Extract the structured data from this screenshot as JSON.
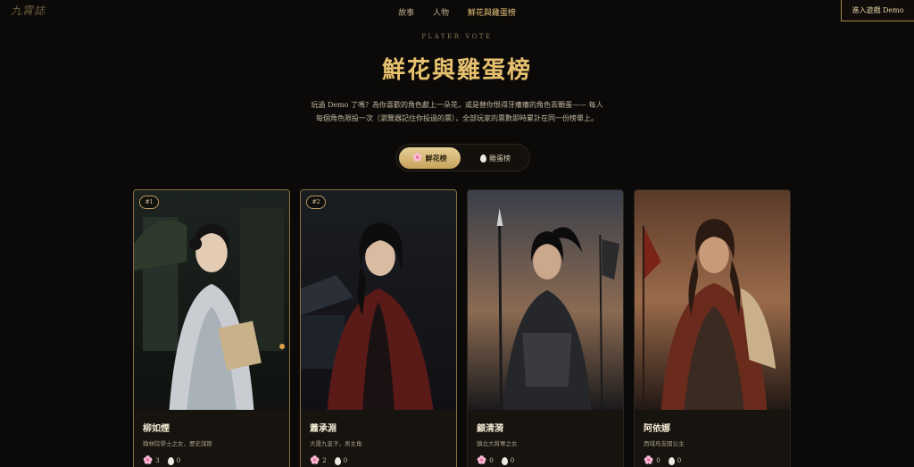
{
  "header": {
    "logo": "九霄誌",
    "nav": [
      "故事",
      "人物",
      "鮮花與雞蛋榜"
    ],
    "enter_button": "進入遊戲 Demo"
  },
  "hero": {
    "eyebrow": "PLAYER VOTE",
    "title": "鮮花與雞蛋榜",
    "description_line1": "玩過 Demo 了嗎？為你喜歡的角色獻上一朵花，或是替你恨得牙癢癢的角色丟顆蛋—— 每人",
    "description_line2": "每個角色限投一次（瀏覽器記住你投過的票），全部玩家的票數即時累計在同一份榜單上。"
  },
  "toggle": {
    "flower": "鮮花榜",
    "egg": "雞蛋榜",
    "selected": "鮮花榜"
  },
  "cards": [
    {
      "rank": "#1",
      "name": "柳如煙",
      "role": "翰林院學士之女，歷史謀斯",
      "flowers": "3",
      "eggs": "0"
    },
    {
      "rank": "#2",
      "name": "蕭承淵",
      "role": "大晟九皇子，男主角",
      "flowers": "2",
      "eggs": "0"
    },
    {
      "rank": "",
      "name": "顧清漪",
      "role": "鎮北大將軍之女",
      "flowers": "0",
      "eggs": "0"
    },
    {
      "rank": "",
      "name": "阿依娜",
      "role": "西域烏支國公主",
      "flowers": "0",
      "eggs": "0"
    }
  ],
  "colors": {
    "accent_gold": "#e7c16f",
    "background": "#0c0a08",
    "card": "#17140f"
  }
}
